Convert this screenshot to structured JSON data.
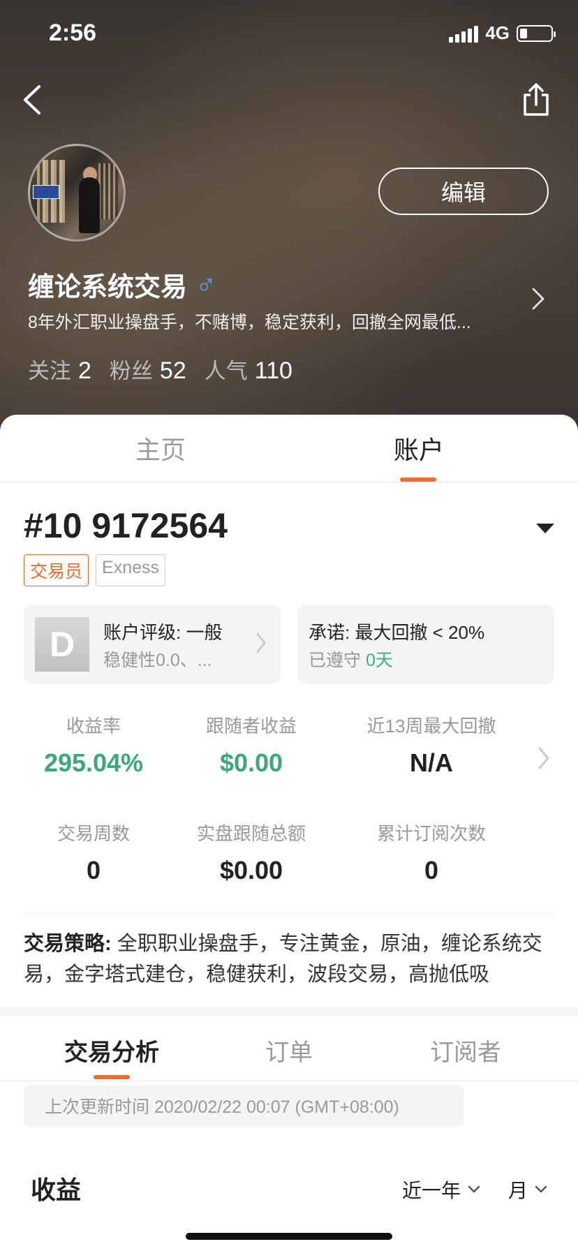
{
  "status_bar": {
    "time": "2:56",
    "network": "4G"
  },
  "profile": {
    "name": "缠论系统交易",
    "gender_symbol": "♂",
    "bio": "8年外汇职业操盘手，不赌博，稳定获利，回撤全网最低...",
    "edit_label": "编辑",
    "stats": {
      "follow_label": "关注",
      "follow_value": "2",
      "fans_label": "粉丝",
      "fans_value": "52",
      "popularity_label": "人气",
      "popularity_value": "110"
    }
  },
  "top_tabs": [
    {
      "label": "主页",
      "active": false
    },
    {
      "label": "账户",
      "active": true
    }
  ],
  "account": {
    "number": "#10 9172564",
    "tags": [
      "交易员",
      "Exness"
    ],
    "rating_card": {
      "grade": "D",
      "title": "账户评级: 一般",
      "subtitle": "稳健性0.0、..."
    },
    "promise_card": {
      "title": "承诺: 最大回撤 < 20%",
      "subtitle_prefix": "已遵守",
      "subtitle_value": "0天"
    }
  },
  "metrics": [
    {
      "label": "收益率",
      "value": "295.04%"
    },
    {
      "label": "跟随者收益",
      "value": "$0.00"
    },
    {
      "label": "近13周最大回撤",
      "value": "N/A"
    },
    {
      "label": "交易周数",
      "value": "0"
    },
    {
      "label": "实盘跟随总额",
      "value": "$0.00"
    },
    {
      "label": "累计订阅次数",
      "value": "0"
    }
  ],
  "strategy": {
    "label": "交易策略:",
    "text": " 全职职业操盘手，专注黄金，原油，缠论系统交易，金字塔式建仓，稳健获利，波段交易，高抛低吸"
  },
  "sub_tabs": [
    {
      "label": "交易分析",
      "active": true
    },
    {
      "label": "订单",
      "active": false
    },
    {
      "label": "订阅者",
      "active": false
    }
  ],
  "last_updated": "上次更新时间 2020/02/22 00:07 (GMT+08:00)",
  "earnings": {
    "title": "收益",
    "range_filter": "近一年",
    "period_filter": "月"
  },
  "colors": {
    "accent": "#f06a2c",
    "positive": "#3ba877",
    "male": "#5b9dff"
  }
}
